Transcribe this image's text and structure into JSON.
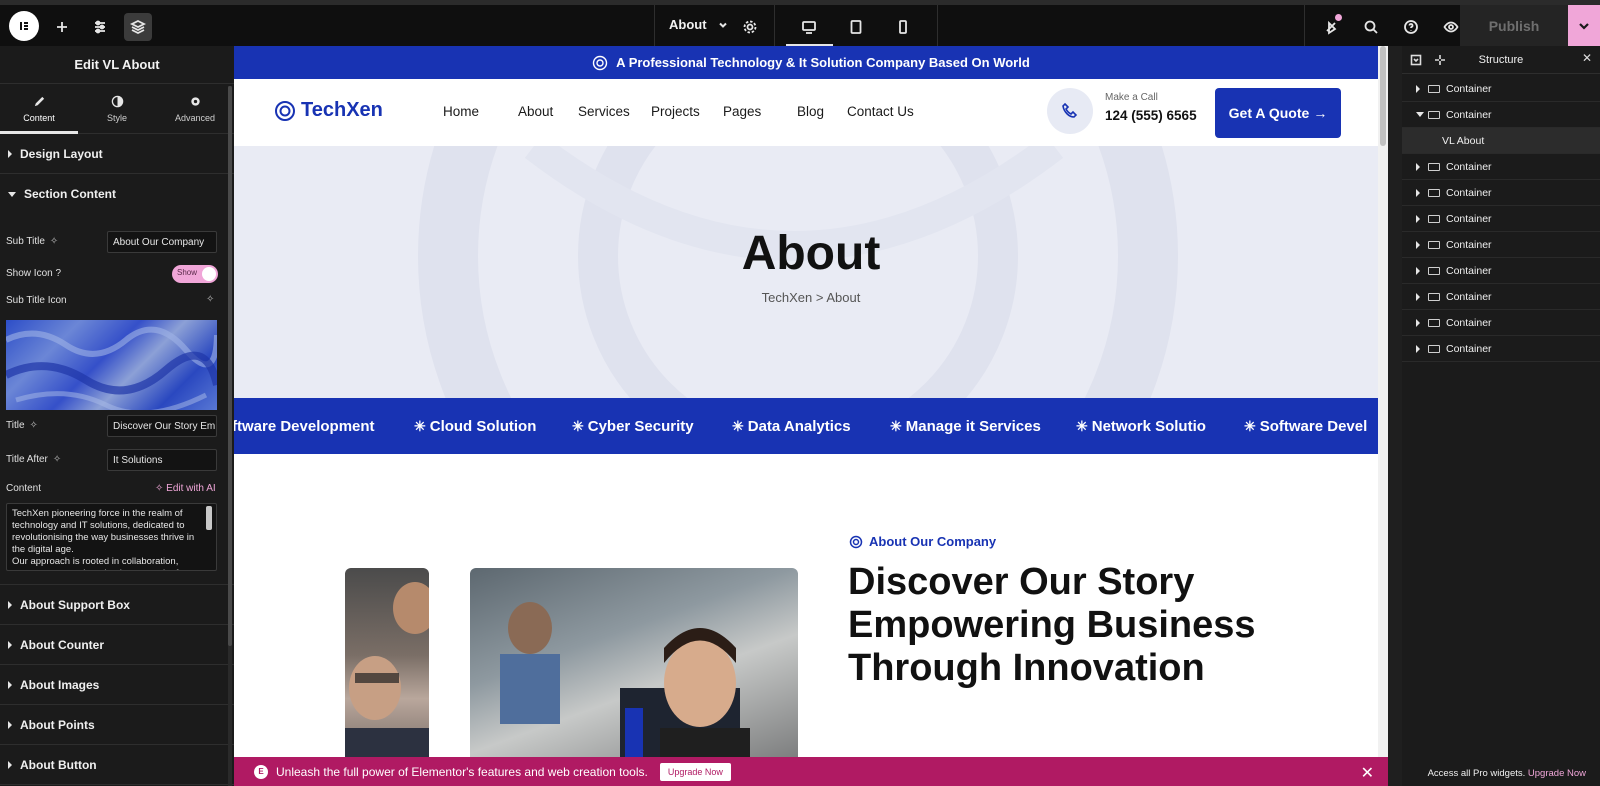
{
  "topbar": {
    "page_name": "About",
    "publish_label": "Publish",
    "icons": [
      "elementor-logo-icon",
      "add-icon",
      "settings-sliders-icon",
      "structure-icon",
      "chevron-down-icon",
      "gear-icon",
      "desktop-icon",
      "tablet-icon",
      "mobile-icon",
      "notifications-icon",
      "search-icon",
      "help-icon",
      "preview-eye-icon"
    ]
  },
  "left_panel": {
    "title": "Edit VL About",
    "tabs": [
      {
        "label": "Content",
        "icon": "pencil-icon"
      },
      {
        "label": "Style",
        "icon": "half-circle-icon"
      },
      {
        "label": "Advanced",
        "icon": "gear-icon"
      }
    ],
    "sections_top": [
      {
        "label": "Design Layout"
      },
      {
        "label": "Section Content"
      }
    ],
    "fields": {
      "sub_title_label": "Sub Title",
      "sub_title_value": "About Our Company",
      "show_icon_label": "Show Icon ?",
      "show_icon_toggle": "Show",
      "sub_title_icon_label": "Sub Title Icon",
      "title_label": "Title",
      "title_value": "Discover Our Story Em",
      "title_after_label": "Title After",
      "title_after_value": "It Solutions",
      "content_label": "Content",
      "edit_ai_label": "Edit with AI",
      "content_value": "TechXen pioneering force in the realm of technology and IT solutions, dedicated to revolutionising the way businesses thrive in the digital age.\nOur approach is rooted in collaboration, transparency and a relentless pursuit of"
    },
    "sections_bottom": [
      {
        "label": "About Support Box"
      },
      {
        "label": "About Counter"
      },
      {
        "label": "About Images"
      },
      {
        "label": "About Points"
      },
      {
        "label": "About Button"
      }
    ]
  },
  "site": {
    "top_strip": "A Professional Technology & It Solution Company Based On World",
    "logo_text": "TechXen",
    "nav": [
      "Home",
      "About",
      "Services",
      "Projects",
      "Pages",
      "Blog",
      "Contact Us"
    ],
    "call_small": "Make a Call",
    "call_number": "124 (555) 6565",
    "quote_button": "Get A Quote",
    "hero_title": "About",
    "hero_breadcrumb": "TechXen > About",
    "marquee": [
      "ftware Development",
      "Cloud Solution",
      "Cyber Security",
      "Data Analytics",
      "Manage it Services",
      "Network Solutio",
      "Software Devel"
    ],
    "about_subtitle": "About Our Company",
    "about_title": "Discover Our Story Empowering Business Through Innovation",
    "brand_color": "#1833b3"
  },
  "promo": {
    "text": "Unleash the full power of Elementor's features and web creation tools.",
    "button": "Upgrade Now"
  },
  "right_panel": {
    "title": "Structure",
    "items": [
      {
        "label": "Container",
        "expanded": false
      },
      {
        "label": "Container",
        "expanded": true
      },
      {
        "label": "VL About",
        "child": true
      },
      {
        "label": "Container",
        "expanded": false
      },
      {
        "label": "Container",
        "expanded": false
      },
      {
        "label": "Container",
        "expanded": false
      },
      {
        "label": "Container",
        "expanded": false
      },
      {
        "label": "Container",
        "expanded": false
      },
      {
        "label": "Container",
        "expanded": false
      },
      {
        "label": "Container",
        "expanded": false
      },
      {
        "label": "Container",
        "expanded": false
      }
    ],
    "footer_text": "Access all Pro widgets.",
    "footer_link": "Upgrade Now"
  },
  "colors": {
    "accent_pink": "#f0a6d8",
    "promo_magenta": "#b01a63"
  }
}
